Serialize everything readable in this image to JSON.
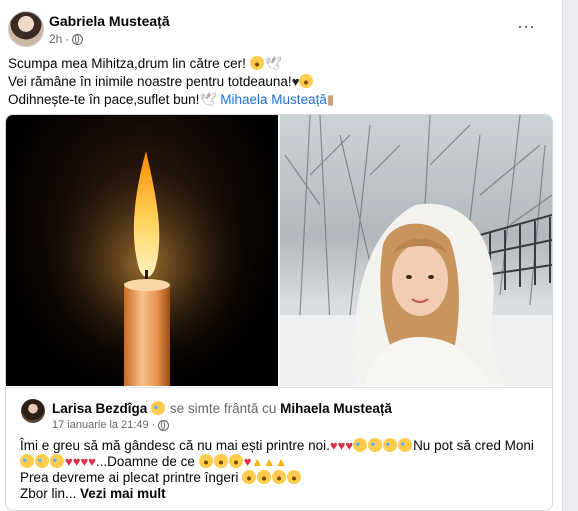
{
  "post": {
    "author": "Gabriela Musteață",
    "time": "2h",
    "dot": "·",
    "more_icon": "⋯",
    "line1": "Scumpa mea Mihitza,drum lin către cer!",
    "line2": "Vei rămâne în inimile noastre pentru totdeauna!",
    "line3": "Odihnește-te în pace,suflet bun!",
    "tag": "Mihaela Musteață"
  },
  "shared": {
    "author": "Larisa Bezdîga",
    "feeling": "se simte frântă cu",
    "tag": "Mihaela Musteață",
    "date": "17 ianuarie la 21:49",
    "dot": "·",
    "text1": "Îmi e greu să mă gândesc că nu mai ești printre noi.",
    "text1b": "Nu pot să  cred Moni",
    "text2": "...Doamne de ce",
    "text3": "Prea devreme ai plecat printre îngeri",
    "text4a": "Zbor lin...",
    "see_more": "Vezi mai mult"
  },
  "colors": {
    "link": "#216fdb",
    "secondary": "#65676b"
  }
}
